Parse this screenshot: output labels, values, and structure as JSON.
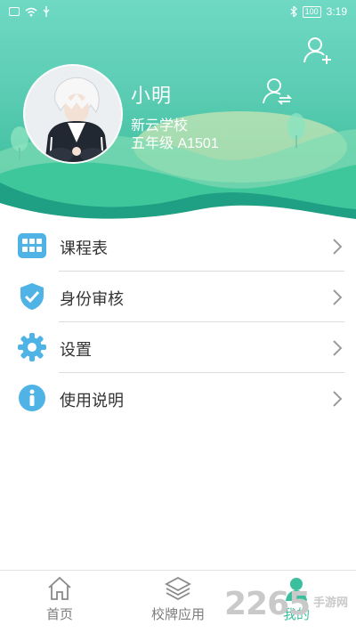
{
  "status_bar": {
    "battery": "100",
    "time": "3:19"
  },
  "profile": {
    "name": "小明",
    "school": "新云学校",
    "class_info": "五年级 A1501"
  },
  "menu": [
    {
      "label": "课程表",
      "icon": "grid-icon"
    },
    {
      "label": "身份审核",
      "icon": "shield-check-icon"
    },
    {
      "label": "设置",
      "icon": "gear-icon"
    },
    {
      "label": "使用说明",
      "icon": "info-icon"
    }
  ],
  "tabs": [
    {
      "label": "首页",
      "icon": "home-icon"
    },
    {
      "label": "校牌应用",
      "icon": "layers-icon"
    },
    {
      "label": "我的",
      "icon": "user-icon",
      "active": true
    }
  ],
  "watermark": {
    "number": "2265",
    "text": "手游网"
  },
  "colors": {
    "accent": "#3bbf9c",
    "header_top": "#6fd9c4",
    "icon_blue": "#4fb3e6"
  }
}
